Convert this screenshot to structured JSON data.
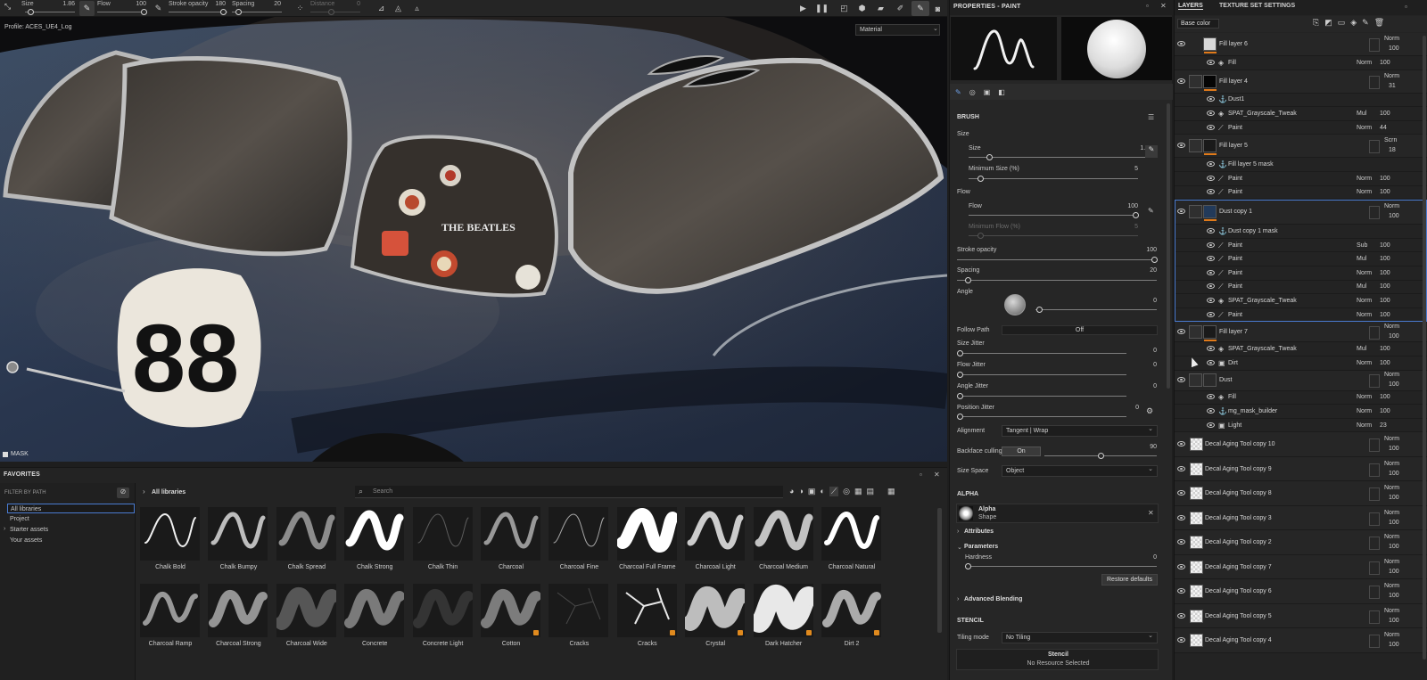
{
  "toolbar": {
    "size_label": "Size",
    "size_value": "1.86",
    "flow_label": "Flow",
    "flow_value": "100",
    "stroke_opacity_label": "Stroke opacity",
    "stroke_opacity_value": "180",
    "spacing_label": "Spacing",
    "spacing_value": "20",
    "distance_label": "Distance",
    "distance_value": "0"
  },
  "viewport": {
    "profile": "Profile: ACES_UE4_Log",
    "material_select": "Material",
    "mask_label": "MASK",
    "decal_number": "88",
    "sticker_text": "THE BEATLES"
  },
  "favorites": {
    "title": "FAVORITES",
    "filter_label": "FILTER BY PATH",
    "tree": [
      "All libraries",
      "Project",
      "Starter assets",
      "Your assets"
    ],
    "breadcrumb": "All libraries",
    "search_placeholder": "Search",
    "row1": [
      "Chalk Bold",
      "Chalk Bumpy",
      "Chalk Spread",
      "Chalk Strong",
      "Chalk Thin",
      "Charcoal",
      "Charcoal Fine",
      "Charcoal Full Frame",
      "Charcoal Light",
      "Charcoal Medium",
      "Charcoal Natural"
    ],
    "row2": [
      "Charcoal Ramp",
      "Charcoal Strong",
      "Charcoal Wide",
      "Concrete",
      "Concrete Light",
      "Cotton",
      "Cracks",
      "Cracks",
      "Crystal",
      "Dark Hatcher",
      "Dirt 2"
    ]
  },
  "properties": {
    "title": "PROPERTIES - PAINT",
    "brush_title": "BRUSH",
    "size_group": "Size",
    "size_label": "Size",
    "size_value": "1.86",
    "min_size_label": "Minimum Size (%)",
    "min_size_value": "5",
    "flow_group": "Flow",
    "flow_label": "Flow",
    "flow_value": "100",
    "min_flow_label": "Minimum Flow (%)",
    "min_flow_value": "5",
    "stroke_opacity_label": "Stroke opacity",
    "stroke_opacity_value": "100",
    "spacing_label": "Spacing",
    "spacing_value": "20",
    "angle_label": "Angle",
    "angle_value": "0",
    "follow_path_label": "Follow Path",
    "follow_path_value": "Off",
    "size_jitter_label": "Size Jitter",
    "size_jitter_value": "0",
    "flow_jitter_label": "Flow Jitter",
    "flow_jitter_value": "0",
    "angle_jitter_label": "Angle Jitter",
    "angle_jitter_value": "0",
    "position_jitter_label": "Position Jitter",
    "position_jitter_value": "0",
    "alignment_label": "Alignment",
    "alignment_value": "Tangent | Wrap",
    "backface_label": "Backface culling",
    "backface_toggle": "On",
    "backface_value": "90",
    "size_space_label": "Size Space",
    "size_space_value": "Object",
    "alpha_title": "ALPHA",
    "alpha_name": "Alpha",
    "alpha_sub": "Shape",
    "attributes_label": "Attributes",
    "parameters_label": "Parameters",
    "hardness_label": "Hardness",
    "hardness_value": "0",
    "restore_label": "Restore defaults",
    "adv_blend_label": "Advanced Blending",
    "stencil_title": "STENCIL",
    "tiling_label": "Tiling mode",
    "tiling_value": "No Tiling",
    "stencil_name": "Stencil",
    "stencil_sub": "No Resource Selected"
  },
  "layers": {
    "tab1": "LAYERS",
    "tab2": "TEXTURE SET SETTINGS",
    "channel": "Base color",
    "rows": [
      {
        "name": "Fill layer 6",
        "blend": "Norm",
        "opacity": "100",
        "type": "layer"
      },
      {
        "name": "Fill",
        "blend": "Norm",
        "opacity": "100",
        "type": "sub"
      },
      {
        "name": "Fill layer 4",
        "blend": "Norm",
        "opacity": "31",
        "type": "layer"
      },
      {
        "name": "Dust1",
        "blend": "",
        "opacity": "",
        "type": "sub"
      },
      {
        "name": "SPAT_Grayscale_Tweak",
        "blend": "Mul",
        "opacity": "100",
        "type": "sub"
      },
      {
        "name": "Paint",
        "blend": "Norm",
        "opacity": "44",
        "type": "sub"
      },
      {
        "name": "Fill layer 5",
        "blend": "Scrn",
        "opacity": "18",
        "type": "layer"
      },
      {
        "name": "Fill layer 5 mask",
        "blend": "",
        "opacity": "",
        "type": "sub"
      },
      {
        "name": "Paint",
        "blend": "Norm",
        "opacity": "100",
        "type": "sub"
      },
      {
        "name": "Paint",
        "blend": "Norm",
        "opacity": "100",
        "type": "sub"
      },
      {
        "name": "Dust copy 1",
        "blend": "Norm",
        "opacity": "100",
        "type": "layer"
      },
      {
        "name": "Dust copy 1 mask",
        "blend": "",
        "opacity": "",
        "type": "sub"
      },
      {
        "name": "Paint",
        "blend": "Sub",
        "opacity": "100",
        "type": "sub"
      },
      {
        "name": "Paint",
        "blend": "Mul",
        "opacity": "100",
        "type": "sub"
      },
      {
        "name": "Paint",
        "blend": "Norm",
        "opacity": "100",
        "type": "sub"
      },
      {
        "name": "Paint",
        "blend": "Mul",
        "opacity": "100",
        "type": "sub"
      },
      {
        "name": "SPAT_Grayscale_Tweak",
        "blend": "Norm",
        "opacity": "100",
        "type": "sub"
      },
      {
        "name": "Paint",
        "blend": "Norm",
        "opacity": "100",
        "type": "sub"
      },
      {
        "name": "Fill layer 7",
        "blend": "Norm",
        "opacity": "100",
        "type": "layer"
      },
      {
        "name": "SPAT_Grayscale_Tweak",
        "blend": "Mul",
        "opacity": "100",
        "type": "sub"
      },
      {
        "name": "Dirt",
        "blend": "Norm",
        "opacity": "100",
        "type": "sub"
      },
      {
        "name": "Dust",
        "blend": "Norm",
        "opacity": "100",
        "type": "layer"
      },
      {
        "name": "Fill",
        "blend": "Norm",
        "opacity": "100",
        "type": "sub"
      },
      {
        "name": "mg_mask_builder",
        "blend": "Norm",
        "opacity": "100",
        "type": "sub"
      },
      {
        "name": "Light",
        "blend": "Norm",
        "opacity": "23",
        "type": "sub"
      },
      {
        "name": "Decal Aging Tool copy 10",
        "blend": "Norm",
        "opacity": "100",
        "type": "layer"
      },
      {
        "name": "Decal Aging Tool copy 9",
        "blend": "Norm",
        "opacity": "100",
        "type": "layer"
      },
      {
        "name": "Decal Aging Tool copy 8",
        "blend": "Norm",
        "opacity": "100",
        "type": "layer"
      },
      {
        "name": "Decal Aging Tool copy 3",
        "blend": "Norm",
        "opacity": "100",
        "type": "layer"
      },
      {
        "name": "Decal Aging Tool copy 2",
        "blend": "Norm",
        "opacity": "100",
        "type": "layer"
      },
      {
        "name": "Decal Aging Tool copy 7",
        "blend": "Norm",
        "opacity": "100",
        "type": "layer"
      },
      {
        "name": "Decal Aging Tool copy 6",
        "blend": "Norm",
        "opacity": "100",
        "type": "layer"
      },
      {
        "name": "Decal Aging Tool copy 5",
        "blend": "Norm",
        "opacity": "100",
        "type": "layer"
      },
      {
        "name": "Decal Aging Tool copy 4",
        "blend": "Norm",
        "opacity": "100",
        "type": "layer"
      }
    ]
  },
  "colors": {
    "accent": "#e07a1a",
    "selection": "#4a7bd0"
  }
}
